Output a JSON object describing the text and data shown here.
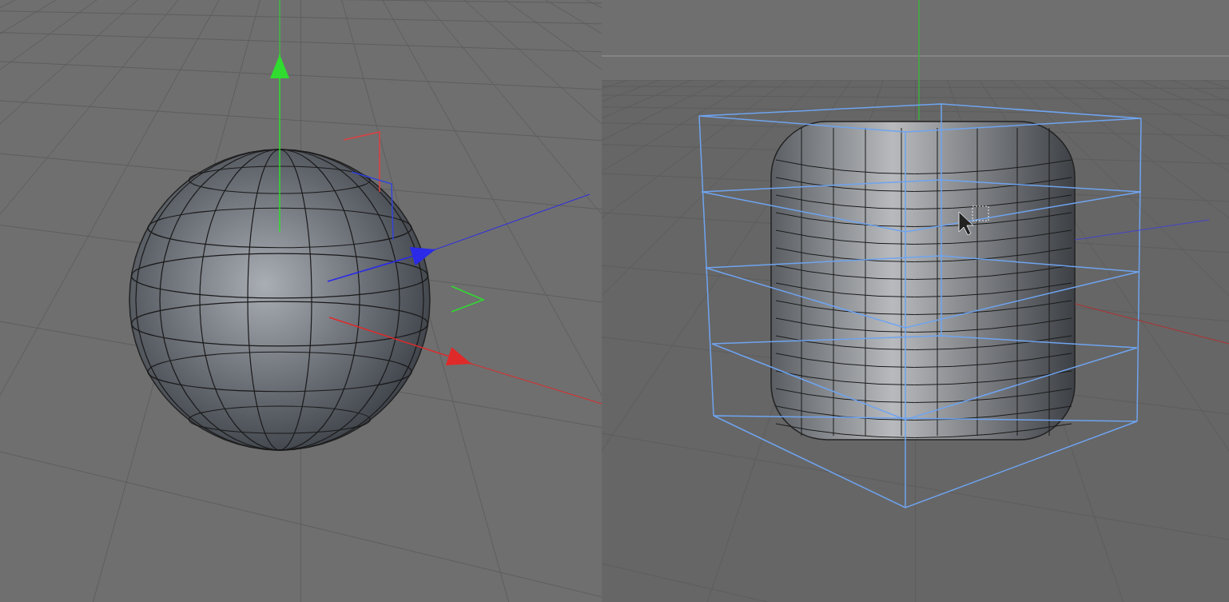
{
  "viewports": [
    {
      "kind": "sphere"
    },
    {
      "kind": "rounded-cube"
    }
  ]
}
